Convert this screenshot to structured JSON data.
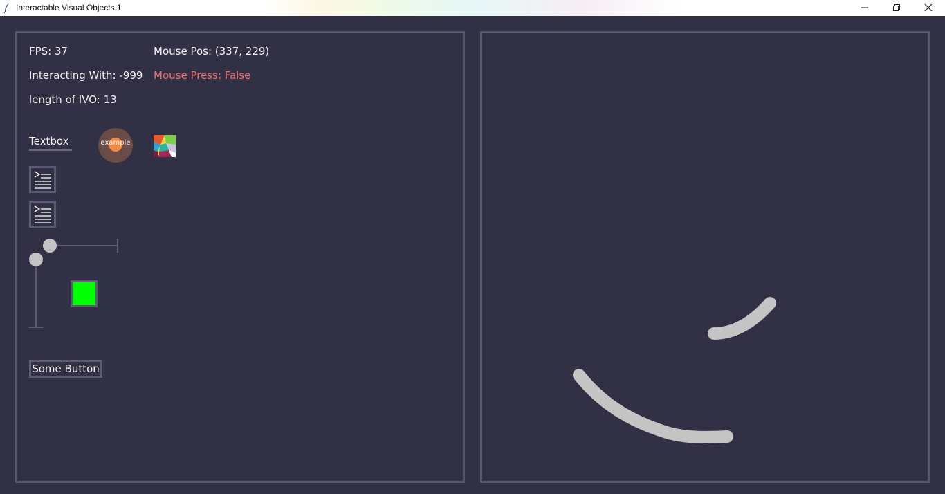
{
  "window": {
    "title": "Interactable Visual Objects 1"
  },
  "stats": {
    "fps": "FPS: 37",
    "mouse_pos": "Mouse Pos: (337, 229)",
    "interacting_with": "Interacting With: -999",
    "mouse_press": "Mouse Press: False",
    "ivo_length": "length of IVO: 13"
  },
  "widgets": {
    "textbox_label": "Textbox",
    "toggle_label": "example",
    "button_label": "Some Button",
    "color_box_color": "#00ff00",
    "horizontal_slider_value": 0,
    "vertical_slider_value": 0
  },
  "colors": {
    "background": "#313044",
    "panel_border": "#595670",
    "text": "#f2f2f2",
    "alert_text": "#ee6e6e",
    "stroke": "#c4c4c4",
    "toggle_outer": "#6a4b46",
    "toggle_inner": "#f08a3e"
  },
  "icons": {
    "app": "feather-icon",
    "list_button": "indent-list-icon",
    "minimize": "minimize-icon",
    "restore": "restore-icon",
    "close": "close-icon"
  }
}
